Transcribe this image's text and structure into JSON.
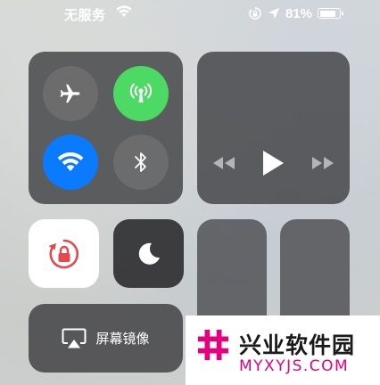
{
  "status_bar": {
    "carrier": "无服务",
    "battery_percent": "81%",
    "battery_level": 0.81,
    "icons": [
      "wifi-icon",
      "rotation-lock-icon",
      "location-arrow-icon",
      "battery-icon"
    ]
  },
  "connectivity": {
    "airplane": {
      "icon": "airplane-icon",
      "active": false
    },
    "cellular": {
      "icon": "cellular-antenna-icon",
      "active": true,
      "color": "#4cd964"
    },
    "wifi": {
      "icon": "wifi-icon",
      "active": true,
      "color": "#0a7aff"
    },
    "bluetooth": {
      "icon": "bluetooth-icon",
      "active": false
    }
  },
  "media": {
    "controls": [
      "rewind-icon",
      "play-icon",
      "fast-forward-icon"
    ]
  },
  "rotation_lock": {
    "icon": "rotation-lock-icon",
    "active": true,
    "color": "#e5484d"
  },
  "do_not_disturb": {
    "icon": "moon-icon",
    "active": false
  },
  "screen_mirroring": {
    "label": "屏幕镜像",
    "icon": "airplay-icon"
  },
  "watermark": {
    "title": "兴业软件园",
    "url": "MYXYJS.COM",
    "accent": "#e6007e"
  }
}
